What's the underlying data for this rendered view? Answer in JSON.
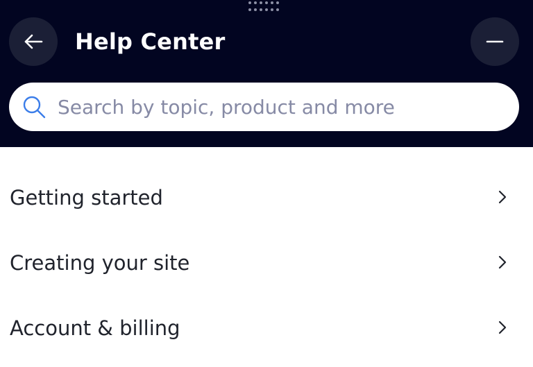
{
  "header": {
    "title": "Help Center",
    "back_icon": "arrow-left-icon",
    "minimize_icon": "minus-icon",
    "drag_handle_icon": "drag-handle-icon"
  },
  "search": {
    "placeholder": "Search by topic, product and more",
    "value": "",
    "icon": "search-icon"
  },
  "topics": [
    {
      "label": "Getting started",
      "icon": "chevron-right-icon"
    },
    {
      "label": "Creating your site",
      "icon": "chevron-right-icon"
    },
    {
      "label": "Account & billing",
      "icon": "chevron-right-icon"
    }
  ],
  "colors": {
    "header_background": "#020521",
    "button_background": "#1b1f36",
    "search_icon": "#3b7de9",
    "placeholder": "#868aa5",
    "text": "#20232c"
  }
}
